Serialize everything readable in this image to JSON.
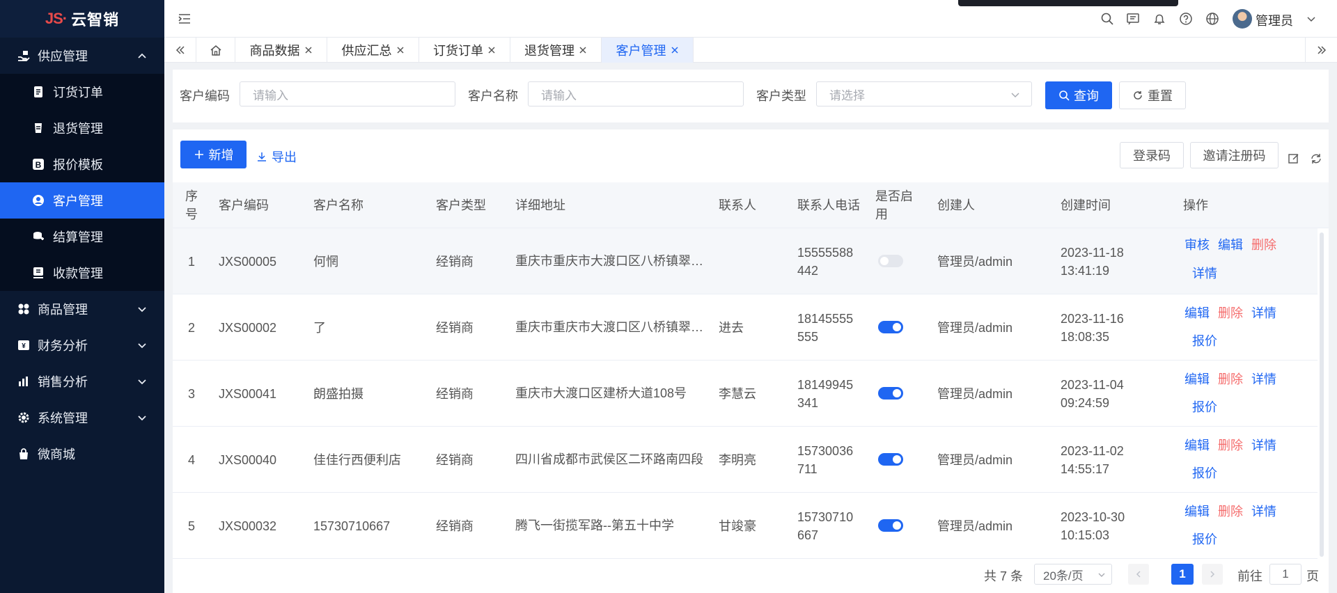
{
  "app": {
    "logo_mark": "JS·",
    "logo_text": "云智销"
  },
  "sidebar": {
    "group_supply": "供应管理",
    "items": [
      {
        "label": "订货订单"
      },
      {
        "label": "退货管理"
      },
      {
        "label": "报价模板"
      },
      {
        "label": "客户管理"
      },
      {
        "label": "结算管理"
      },
      {
        "label": "收款管理"
      }
    ],
    "groups": [
      {
        "label": "商品管理"
      },
      {
        "label": "财务分析"
      },
      {
        "label": "销售分析"
      },
      {
        "label": "系统管理"
      }
    ],
    "mall": "微商城"
  },
  "header": {
    "user_name": "管理员"
  },
  "tabs": [
    {
      "label": "商品数据"
    },
    {
      "label": "供应汇总"
    },
    {
      "label": "订货订单"
    },
    {
      "label": "退货管理"
    },
    {
      "label": "客户管理"
    }
  ],
  "search": {
    "code_label": "客户编码",
    "code_placeholder": "请输入",
    "name_label": "客户名称",
    "name_placeholder": "请输入",
    "type_label": "客户类型",
    "type_placeholder": "请选择",
    "query_btn": "查询",
    "reset_btn": "重置"
  },
  "toolbar": {
    "add_btn": "新增",
    "export_btn": "导出",
    "login_code_btn": "登录码",
    "invite_btn": "邀请注册码"
  },
  "table": {
    "headers": {
      "idx": "序号",
      "code": "客户编码",
      "name": "客户名称",
      "type": "客户类型",
      "addr": "详细地址",
      "contact": "联系人",
      "phone": "联系人电话",
      "enabled": "是否启用",
      "creator": "创建人",
      "created": "创建时间",
      "ops": "操作"
    },
    "rows": [
      {
        "idx": "1",
        "code": "JXS00005",
        "name": "何惘",
        "type": "经销商",
        "addr": "重庆市重庆市大渡口区八桥镇翠园路",
        "contact": "",
        "phone": "15555588442",
        "enabled": false,
        "creator": "管理员/admin",
        "created": "2023-11-18 13:41:19",
        "actions": [
          "审核",
          "编辑",
          "删除",
          "详情"
        ]
      },
      {
        "idx": "2",
        "code": "JXS00002",
        "name": "了",
        "type": "经销商",
        "addr": "重庆市重庆市大渡口区八桥镇翠园路",
        "contact": "进去",
        "phone": "18145555555",
        "enabled": true,
        "creator": "管理员/admin",
        "created": "2023-11-16 18:08:35",
        "actions": [
          "编辑",
          "删除",
          "详情",
          "报价"
        ]
      },
      {
        "idx": "3",
        "code": "JXS00041",
        "name": "朗盛拍摄",
        "type": "经销商",
        "addr": "重庆市大渡口区建桥大道108号",
        "contact": "李慧云",
        "phone": "18149945341",
        "enabled": true,
        "creator": "管理员/admin",
        "created": "2023-11-04 09:24:59",
        "actions": [
          "编辑",
          "删除",
          "详情",
          "报价"
        ]
      },
      {
        "idx": "4",
        "code": "JXS00040",
        "name": "佳佳行西便利店",
        "type": "经销商",
        "addr": "四川省成都市武侯区二环路南四段",
        "contact": "李明亮",
        "phone": "15730036711",
        "enabled": true,
        "creator": "管理员/admin",
        "created": "2023-11-02 14:55:17",
        "actions": [
          "编辑",
          "删除",
          "详情",
          "报价"
        ]
      },
      {
        "idx": "5",
        "code": "JXS00032",
        "name": "15730710667",
        "type": "经销商",
        "addr": "腾飞一街揽军路--第五十中学",
        "contact": "甘竣豪",
        "phone": "15730710667",
        "enabled": true,
        "creator": "管理员/admin",
        "created": "2023-10-30 10:15:03",
        "actions": [
          "编辑",
          "删除",
          "详情",
          "报价"
        ]
      }
    ]
  },
  "pagination": {
    "total": "共 7 条",
    "page_size": "20条/页",
    "current": "1",
    "goto_prefix": "前往",
    "goto_value": "1",
    "goto_suffix": "页"
  },
  "colors": {
    "primary": "#1f66f2",
    "sidebar_bg": "#0b1931",
    "danger": "#f56c6c"
  }
}
